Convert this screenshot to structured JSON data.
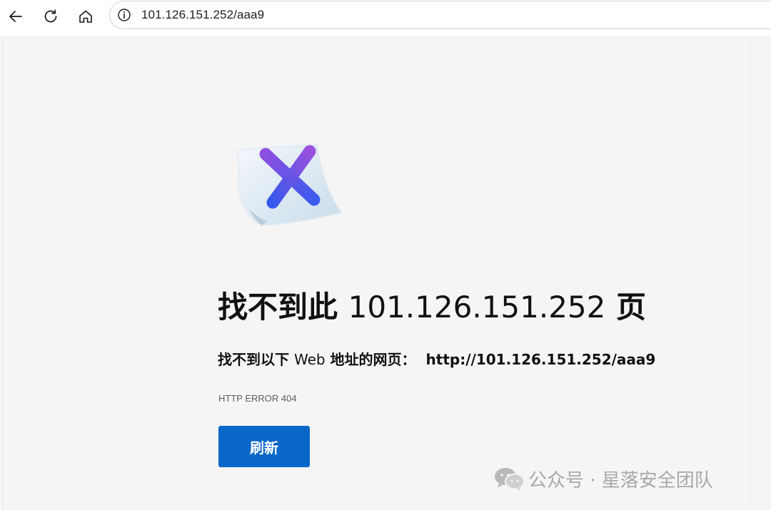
{
  "browser": {
    "address_bar": {
      "url": "101.126.151.252/aaa9"
    },
    "icons": {
      "back": "back-arrow-icon",
      "refresh": "refresh-icon",
      "home": "home-icon",
      "site_info": "info-icon"
    }
  },
  "error_page": {
    "illustration": "error-x-icon",
    "title_prefix": "找不到此",
    "title_host": "101.126.151.252",
    "title_suffix": "页",
    "subtitle_prefix": "找不到以下",
    "subtitle_web": "Web",
    "subtitle_suffix": "地址的网页：",
    "subtitle_url": "http://101.126.151.252/aaa9",
    "error_code": "HTTP ERROR 404",
    "refresh_button": "刷新"
  },
  "watermark": {
    "icon": "wechat-icon",
    "text": "公众号 · 星落安全团队"
  },
  "colors": {
    "page_background": "#f5f5f5",
    "button_blue": "#0867c8",
    "x_gradient_start": "#8d4fe0",
    "x_gradient_end": "#3b5bef"
  }
}
